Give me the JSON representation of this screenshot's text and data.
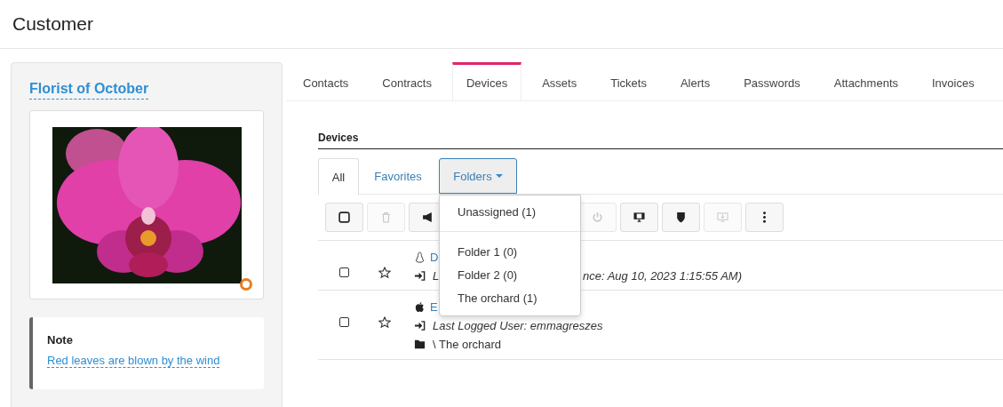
{
  "page_title": "Customer",
  "customer": {
    "name": "Florist of October",
    "note": {
      "heading": "Note",
      "text": "Red leaves are blown by the wind"
    }
  },
  "tabs": [
    {
      "label": "Contacts",
      "selected": false
    },
    {
      "label": "Contracts",
      "selected": false
    },
    {
      "label": "Devices",
      "selected": true
    },
    {
      "label": "Assets",
      "selected": false
    },
    {
      "label": "Tickets",
      "selected": false
    },
    {
      "label": "Alerts",
      "selected": false
    },
    {
      "label": "Passwords",
      "selected": false
    },
    {
      "label": "Attachments",
      "selected": false
    },
    {
      "label": "Invoices",
      "selected": false
    }
  ],
  "section_title": "Devices",
  "subtabs": [
    {
      "label": "All",
      "selected": true,
      "kind": "tab"
    },
    {
      "label": "Favorites",
      "selected": false,
      "kind": "tab"
    },
    {
      "label": "Folders",
      "selected": false,
      "kind": "dropdown"
    }
  ],
  "folder_menu": {
    "items": [
      {
        "label": "Unassigned (1)",
        "kind": "item"
      },
      {
        "kind": "divider"
      },
      {
        "label": "Folder 1 (0)",
        "kind": "item"
      },
      {
        "label": "Folder 2 (0)",
        "kind": "item"
      },
      {
        "label": "The orchard (1)",
        "kind": "item"
      }
    ]
  },
  "toolbar_left": [
    {
      "kind": "checkbox",
      "disabled": false
    },
    {
      "kind": "trash",
      "disabled": true
    },
    {
      "kind": "megaphone",
      "disabled": false
    }
  ],
  "toolbar_right": [
    {
      "kind": "power",
      "disabled": true
    },
    {
      "kind": "monitor-question",
      "disabled": false
    },
    {
      "kind": "shield",
      "disabled": false
    },
    {
      "kind": "monitor-download",
      "disabled": true
    },
    {
      "kind": "more",
      "disabled": false
    }
  ],
  "rows": [
    {
      "checked": false,
      "favorite": false,
      "kind": "linux",
      "name": "D",
      "lines": [
        {
          "kind": "login",
          "parts": [
            "L",
            "nce: Aug 10, 2023 1:15:55 AM)"
          ]
        }
      ]
    },
    {
      "checked": false,
      "favorite": false,
      "kind": "apple",
      "name": "E",
      "lines": [
        {
          "kind": "login",
          "parts": [
            "Last Logged User: emmagreszes"
          ]
        },
        {
          "kind": "folder",
          "parts": [
            "\\ The orchard"
          ]
        }
      ]
    }
  ]
}
